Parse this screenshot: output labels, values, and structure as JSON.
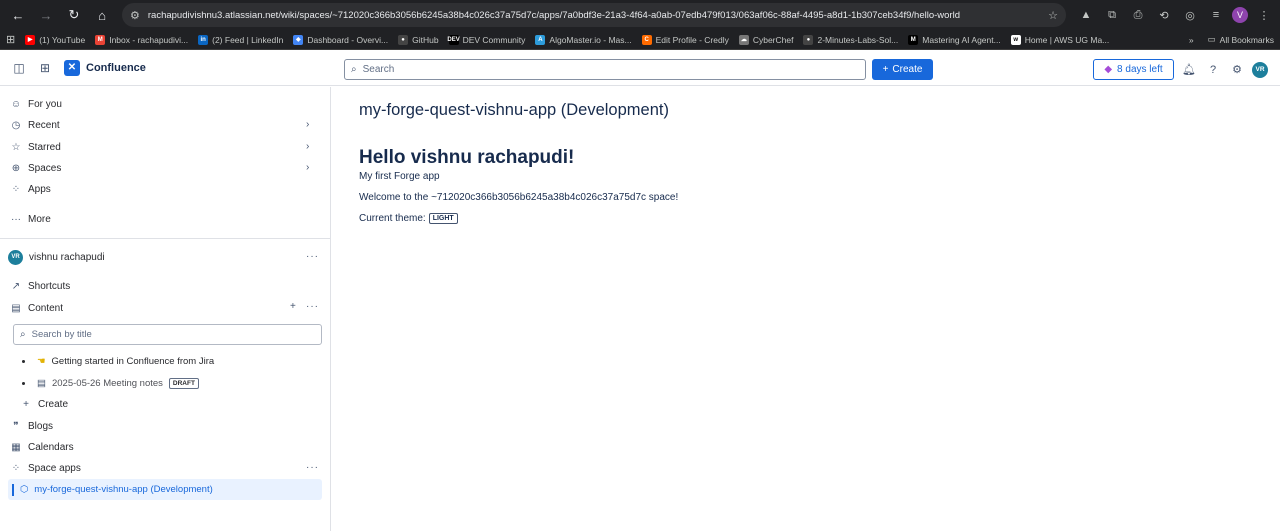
{
  "browser": {
    "url": "rachapudivishnu3.atlassian.net/wiki/spaces/~712020c366b3056b6245a38b4c026c37a75d7c/apps/7a0bdf3e-21a3-4f64-a0ab-07edb479f013/063af06c-88af-4495-a8d1-1b307ceb34f9/hello-world",
    "profile_initial": "V",
    "bookmarks": [
      {
        "label": "(1) YouTube",
        "color": "#ff0000",
        "glyph": "▶"
      },
      {
        "label": "Inbox - rachapudivi...",
        "color": "#ea4335",
        "glyph": "M"
      },
      {
        "label": "(2) Feed | LinkedIn",
        "color": "#0a66c2",
        "glyph": "in"
      },
      {
        "label": "Dashboard - Overvi...",
        "color": "#4285f4",
        "glyph": "◆"
      },
      {
        "label": "GitHub",
        "color": "#444444",
        "glyph": "●"
      },
      {
        "label": "DEV Community",
        "color": "#000000",
        "glyph": "DEV"
      },
      {
        "label": "AlgoMaster.io - Mas...",
        "color": "#2d9cdb",
        "glyph": "A"
      },
      {
        "label": "Edit Profile - Credly",
        "color": "#ff6b00",
        "glyph": "C"
      },
      {
        "label": "CyberChef",
        "color": "#777777",
        "glyph": "☁"
      },
      {
        "label": "2-Minutes-Labs-Sol...",
        "color": "#444444",
        "glyph": "●"
      },
      {
        "label": "Mastering AI Agent...",
        "color": "#000000",
        "glyph": "M"
      },
      {
        "label": "Home | AWS UG Ma...",
        "color": "#ffffff",
        "glyph": "w"
      }
    ],
    "bookmarks_more": "»",
    "all_bookmarks": "All Bookmarks"
  },
  "topbar": {
    "product": "Confluence",
    "search_placeholder": "Search",
    "create_label": "Create",
    "trial_label": "8 days left",
    "avatar_initials": "VR"
  },
  "sidebar": {
    "for_you": "For you",
    "recent": "Recent",
    "starred": "Starred",
    "spaces": "Spaces",
    "apps": "Apps",
    "more": "More",
    "space_owner": "vishnu rachapudi",
    "owner_initials": "VR",
    "shortcuts": "Shortcuts",
    "content": "Content",
    "search_placeholder": "Search by title",
    "tree": [
      {
        "label": "Getting started in Confluence from Jira"
      },
      {
        "label": "2025-05-26 Meeting notes",
        "badge": "DRAFT"
      }
    ],
    "create": "Create",
    "blogs": "Blogs",
    "calendars": "Calendars",
    "space_apps": "Space apps",
    "active_app": "my-forge-quest-vishnu-app (Development)"
  },
  "main": {
    "title": "my-forge-quest-vishnu-app (Development)",
    "hello": "Hello vishnu rachapudi!",
    "subtitle": "My first Forge app",
    "welcome": "Welcome to the ~712020c366b3056b6245a38b4c026c37a75d7c space!",
    "theme_label": "Current theme:",
    "theme_value": "LIGHT"
  }
}
